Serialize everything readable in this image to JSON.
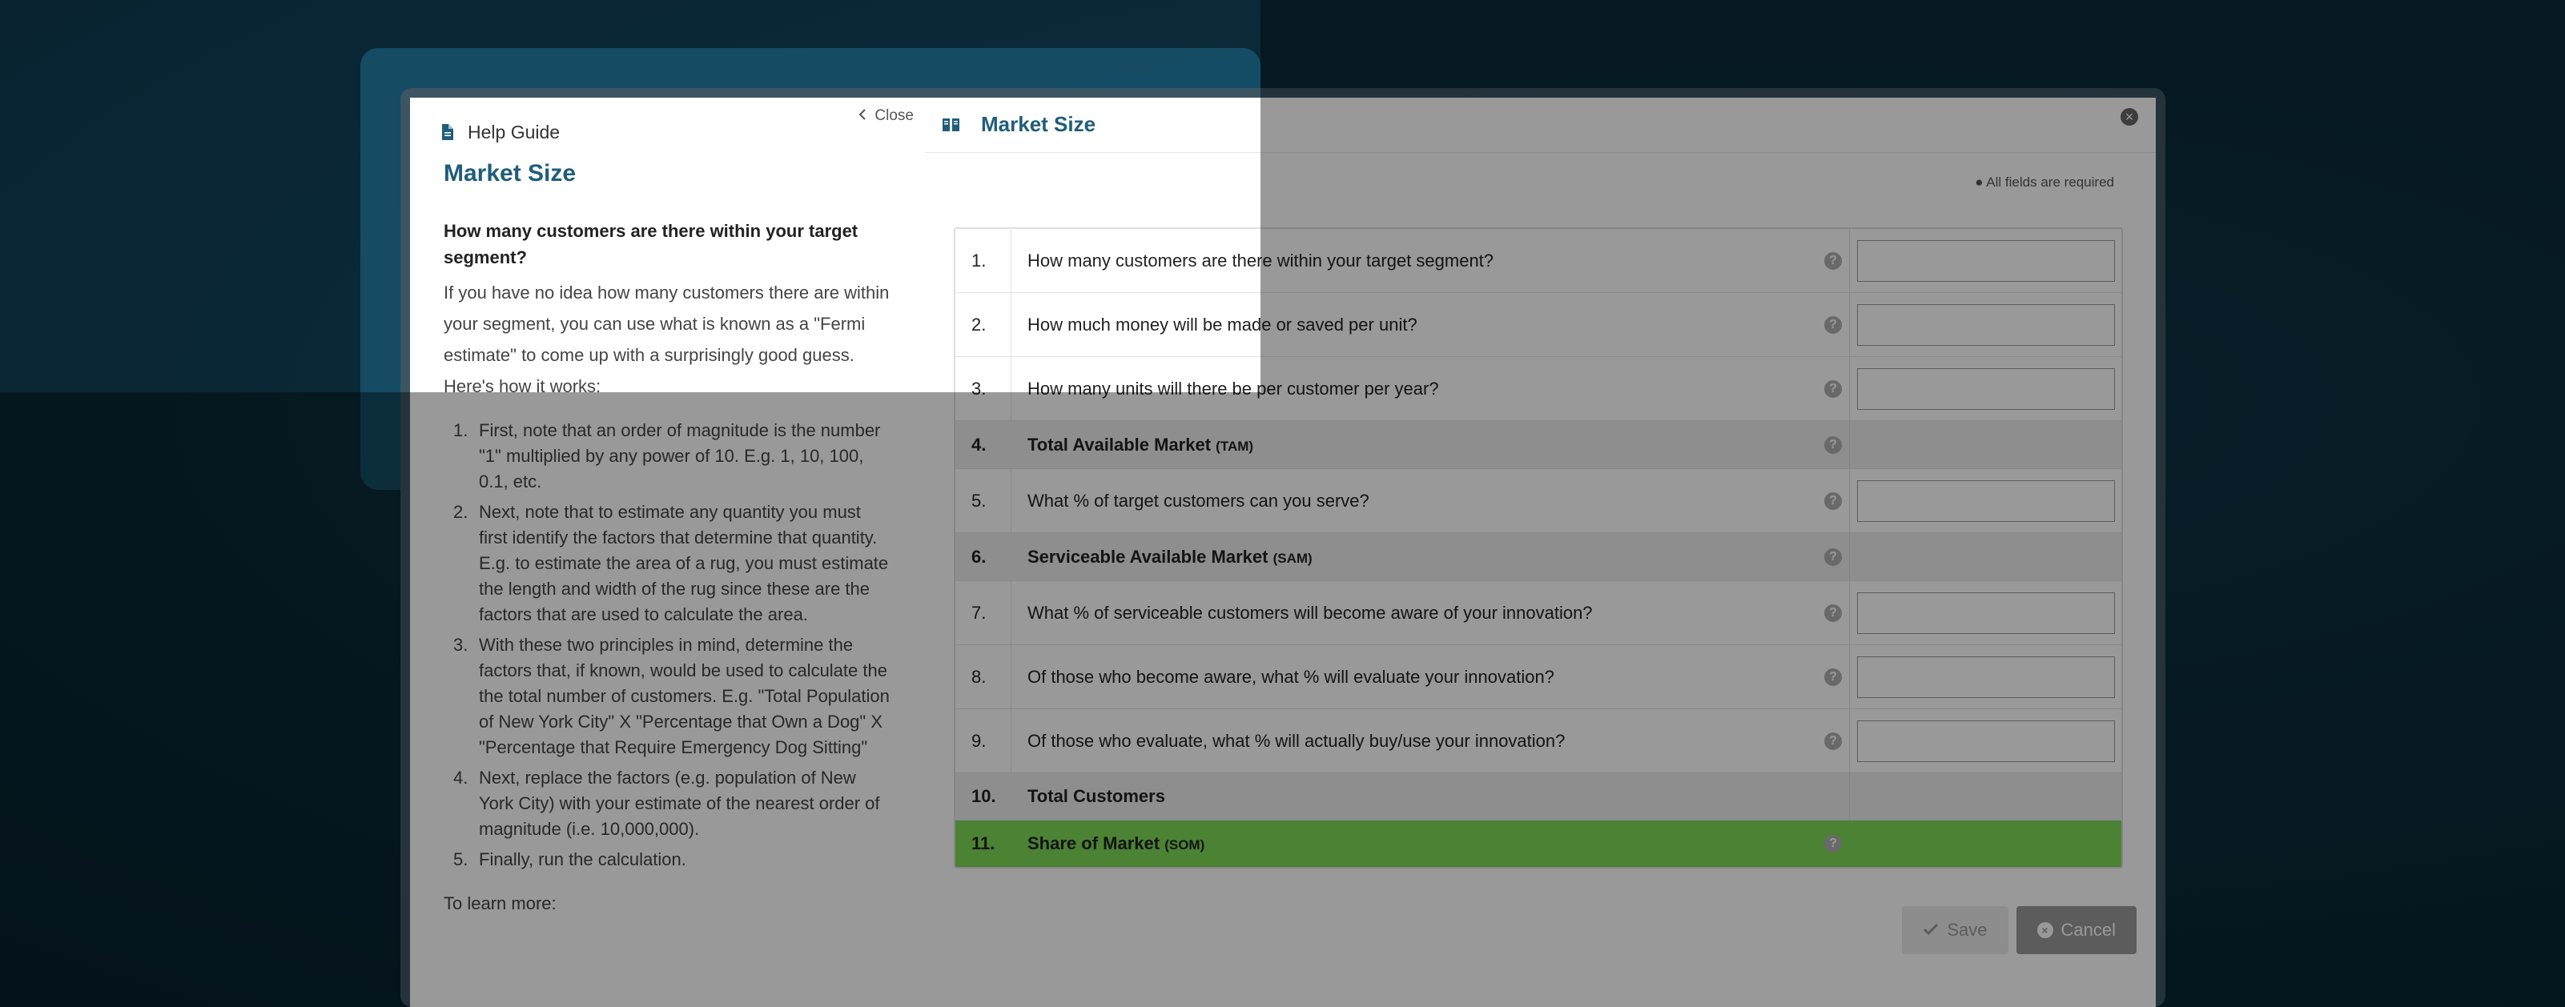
{
  "help": {
    "header_title": "Help Guide",
    "close_label": "Close",
    "title": "Market Size",
    "question": "How many customers are there within your target segment?",
    "intro": "If you have no idea how many customers there are within your segment, you can use what is known as a \"Fermi estimate\" to come up with a surprisingly good guess. Here's how it works:",
    "steps": [
      {
        "n": "1.",
        "text": "First, note that an order of magnitude is the number \"1\" multiplied by any power of 10. E.g. 1, 10, 100, 0.1, etc."
      },
      {
        "n": "2.",
        "text": "Next, note that to estimate any quantity you must first identify the factors that determine that quantity. E.g. to estimate the area of a rug, you must estimate the length and width of the rug since these are the factors that are used to calculate the area."
      },
      {
        "n": "3.",
        "text": "With these two principles in mind, determine the factors that, if known, would be used to calculate the the total number of customers. E.g. \"Total Population of New York City\" X \"Percentage that Own a Dog\" X \"Percentage that Require Emergency Dog Sitting\""
      },
      {
        "n": "4.",
        "text": "Next, replace the factors (e.g. population of New York City) with your estimate of the nearest order of magnitude (i.e. 10,000,000)."
      },
      {
        "n": "5.",
        "text": "Finally, run the calculation."
      }
    ],
    "learn_more": "To learn more:"
  },
  "main": {
    "title": "Market Size",
    "required_note": "All fields are required",
    "rows": [
      {
        "num": "1.",
        "label": "How many customers are there within your target segment?",
        "abbr": ""
      },
      {
        "num": "2.",
        "label": "How much money will be made or saved per unit?",
        "abbr": ""
      },
      {
        "num": "3.",
        "label": "How many units will there be per customer per year?",
        "abbr": ""
      },
      {
        "num": "4.",
        "label": "Total Available Market",
        "abbr": "(TAM)"
      },
      {
        "num": "5.",
        "label": "What % of target customers can you serve?",
        "abbr": ""
      },
      {
        "num": "6.",
        "label": "Serviceable Available Market",
        "abbr": "(SAM)"
      },
      {
        "num": "7.",
        "label": "What % of serviceable customers will become aware of your innovation?",
        "abbr": ""
      },
      {
        "num": "8.",
        "label": "Of those who become aware, what % will evaluate your innovation?",
        "abbr": ""
      },
      {
        "num": "9.",
        "label": "Of those who evaluate, what % will actually buy/use your innovation?",
        "abbr": ""
      },
      {
        "num": "10.",
        "label": "Total Customers",
        "abbr": ""
      },
      {
        "num": "11.",
        "label": "Share of Market",
        "abbr": "(SOM)"
      }
    ],
    "save_label": "Save",
    "cancel_label": "Cancel"
  },
  "colors": {
    "accent": "#1f5d7b",
    "highlight": "#1b5f7c",
    "som_row": "#7ed957"
  }
}
